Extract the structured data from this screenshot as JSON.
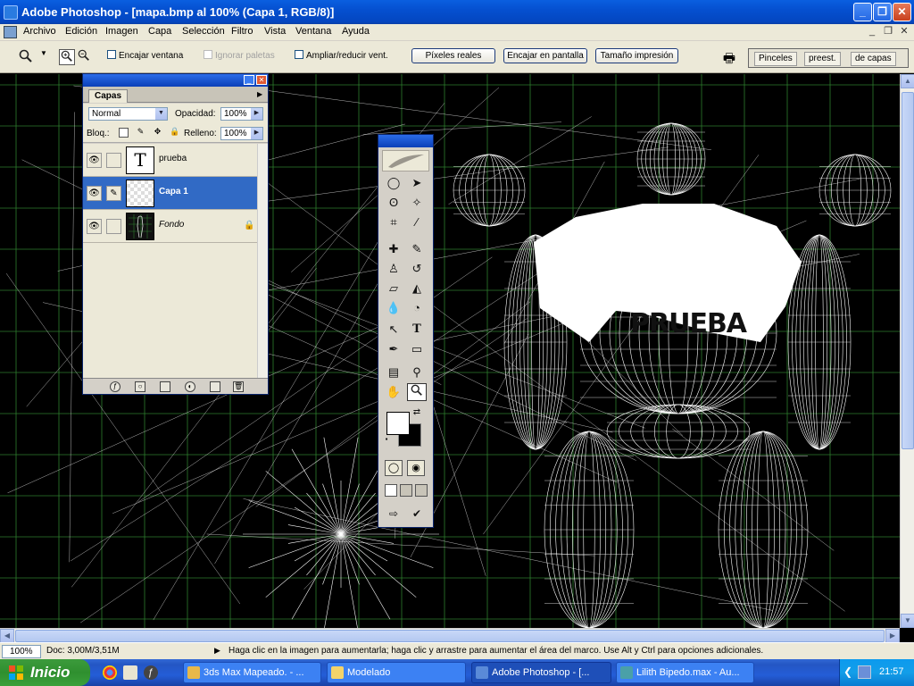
{
  "window": {
    "title": "Adobe Photoshop - [mapa.bmp al 100% (Capa 1, RGB/8)]",
    "minimize": "_",
    "maximize": "❐",
    "close": "✕"
  },
  "menubar": {
    "items": [
      "Archivo",
      "Edición",
      "Imagen",
      "Capa",
      "Selección",
      "Filtro",
      "Vista",
      "Ventana",
      "Ayuda"
    ],
    "mdi_buttons": [
      "_",
      "❐",
      "✕"
    ]
  },
  "options_bar": {
    "tool_icon": "zoom-tool-icon",
    "zoom_in_icon": "zoom-in-icon",
    "zoom_out_icon": "zoom-out-icon",
    "resize_window_label": "Encajar ventana",
    "ignore_palettes_label": "Ignorar paletas",
    "zoom_all_windows_label": "Ampliar/reducir vent.",
    "actual_pixels_label": "Píxeles reales",
    "fit_screen_label": "Encajar en pantalla",
    "print_size_label": "Tamaño impresión",
    "palette_well_tabs": [
      "Pinceles",
      "preest.",
      "de capas"
    ]
  },
  "canvas": {
    "banner_text": "PRUEBA",
    "background_color": "#000000",
    "wire_color_green": "#2e7d2e",
    "wire_color_white": "#ffffff"
  },
  "layers_panel": {
    "tab_label": "Capas",
    "blend_mode": "Normal",
    "opacity_label": "Opacidad:",
    "opacity_value": "100%",
    "lock_label": "Bloq.:",
    "fill_label": "Relleno:",
    "fill_value": "100%",
    "layers": [
      {
        "name": "prueba",
        "thumb": "T",
        "visible": true,
        "selected": false,
        "locked": false
      },
      {
        "name": "Capa 1",
        "thumb": "",
        "visible": true,
        "selected": true,
        "locked": false
      },
      {
        "name": "Fondo",
        "thumb": "",
        "visible": true,
        "selected": false,
        "locked": true
      }
    ],
    "footer_icons": [
      "link-layers-icon",
      "add-layer-style-icon",
      "add-mask-icon",
      "new-group-icon",
      "adjustment-layer-icon",
      "new-layer-icon",
      "delete-layer-icon"
    ]
  },
  "toolbox": {
    "tools": [
      "marquee-icon",
      "move-icon",
      "lasso-icon",
      "magic-wand-icon",
      "crop-icon",
      "slice-icon",
      "healing-icon",
      "brush-icon",
      "stamp-icon",
      "history-brush-icon",
      "eraser-icon",
      "bucket-icon",
      "blur-icon",
      "dodge-icon",
      "path-select-icon",
      "type-icon",
      "pen-icon",
      "shape-icon",
      "notes-icon",
      "eyedropper-icon",
      "hand-icon",
      "zoom-icon"
    ],
    "type_glyph": "T"
  },
  "statusbar": {
    "zoom": "100%",
    "doc_info": "Doc: 3,00M/3,51M",
    "hint": "Haga clic en la imagen para aumentarla; haga clic y arrastre para aumentar el área del marco. Use Alt y Ctrl para opciones adicionales."
  },
  "taskbar": {
    "start_label": "Inicio",
    "tasks": [
      {
        "label": "3ds Max Mapeado. - ...",
        "active": false,
        "color": "#e8b84a"
      },
      {
        "label": "Modelado",
        "active": false,
        "color": "#f4d36a"
      },
      {
        "label": "Adobe Photoshop - [...",
        "active": true,
        "color": "#5a8ad8"
      },
      {
        "label": "Lilith Bipedo.max - Au...",
        "active": false,
        "color": "#4aa0a8"
      }
    ],
    "clock": "21:57"
  }
}
